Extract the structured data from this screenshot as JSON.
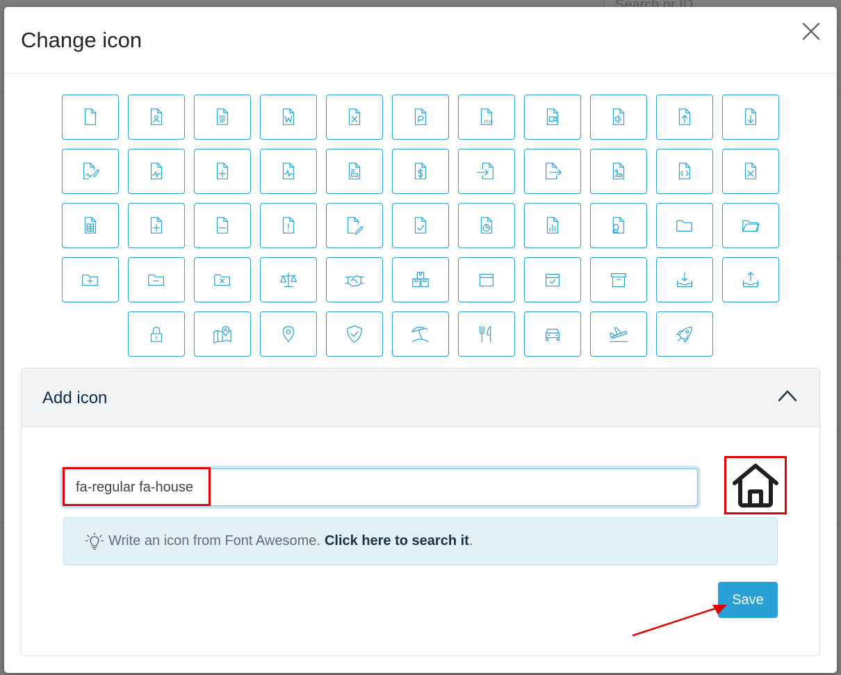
{
  "background": {
    "search_placeholder": "Search or ID"
  },
  "modal": {
    "title": "Change icon",
    "icons": [
      "file-icon",
      "file-user-icon",
      "file-lines-icon",
      "file-word-icon",
      "file-excel-icon",
      "file-powerpoint-icon",
      "file-pdf-icon",
      "file-video-icon",
      "file-audio-icon",
      "file-arrow-up-icon",
      "file-arrow-down-icon",
      "file-signature-icon",
      "file-waveform-icon",
      "file-medical-icon",
      "file-heartbeat-icon",
      "file-invoice-icon",
      "file-dollar-icon",
      "file-import-icon",
      "file-export-icon",
      "file-image-icon",
      "file-code-icon",
      "file-xmark-icon",
      "file-spreadsheet-icon",
      "file-plus-icon",
      "file-minus-icon",
      "file-exclamation-icon",
      "file-pen-icon",
      "file-check-icon",
      "file-chart-pie-icon",
      "file-chart-column-icon",
      "file-certificate-icon",
      "folder-icon",
      "folder-open-icon",
      "folder-plus-icon",
      "folder-minus-icon",
      "folder-xmark-icon",
      "scale-balanced-icon",
      "handshake-icon",
      "boxes-stacked-icon",
      "box-icon",
      "box-check-icon",
      "box-archive-icon",
      "inbox-download-icon",
      "inbox-upload-icon",
      "lock-icon",
      "map-location-icon",
      "location-pin-icon",
      "shield-check-icon",
      "umbrella-beach-icon",
      "utensils-icon",
      "car-icon",
      "plane-departure-icon",
      "rocket-icon"
    ]
  },
  "add_icon": {
    "title": "Add icon",
    "input_value": "fa-regular fa-house",
    "info_text": "Write an icon from Font Awesome.",
    "info_link": "Click here to search it",
    "info_suffix": ".",
    "save_label": "Save"
  },
  "colors": {
    "accent": "#2aa1cf",
    "annotation": "#e00000"
  }
}
